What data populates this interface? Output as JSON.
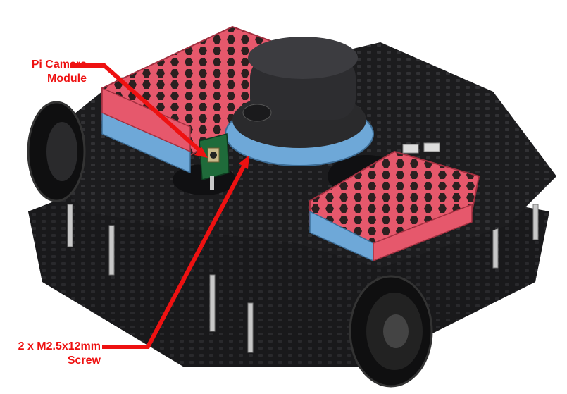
{
  "callouts": {
    "camera": {
      "line1": "Pi Camera",
      "line2": "Module"
    },
    "screw": {
      "line1": "2 x M2.5x12mm",
      "line2": "Screw"
    }
  },
  "colors": {
    "frame": "#1c1c1e",
    "case_red": "#e6586c",
    "case_blue": "#6ea8d8",
    "lidar": "#2a2a2c",
    "standoff": "#c8c8c8",
    "callout": "#ee1111",
    "background": "#ffffff"
  },
  "parts": [
    "robot-chassis",
    "lidar-sensor",
    "pi-case-left",
    "pi-case-right",
    "pi-camera-module",
    "wheel-left",
    "wheel-front",
    "standoffs"
  ]
}
